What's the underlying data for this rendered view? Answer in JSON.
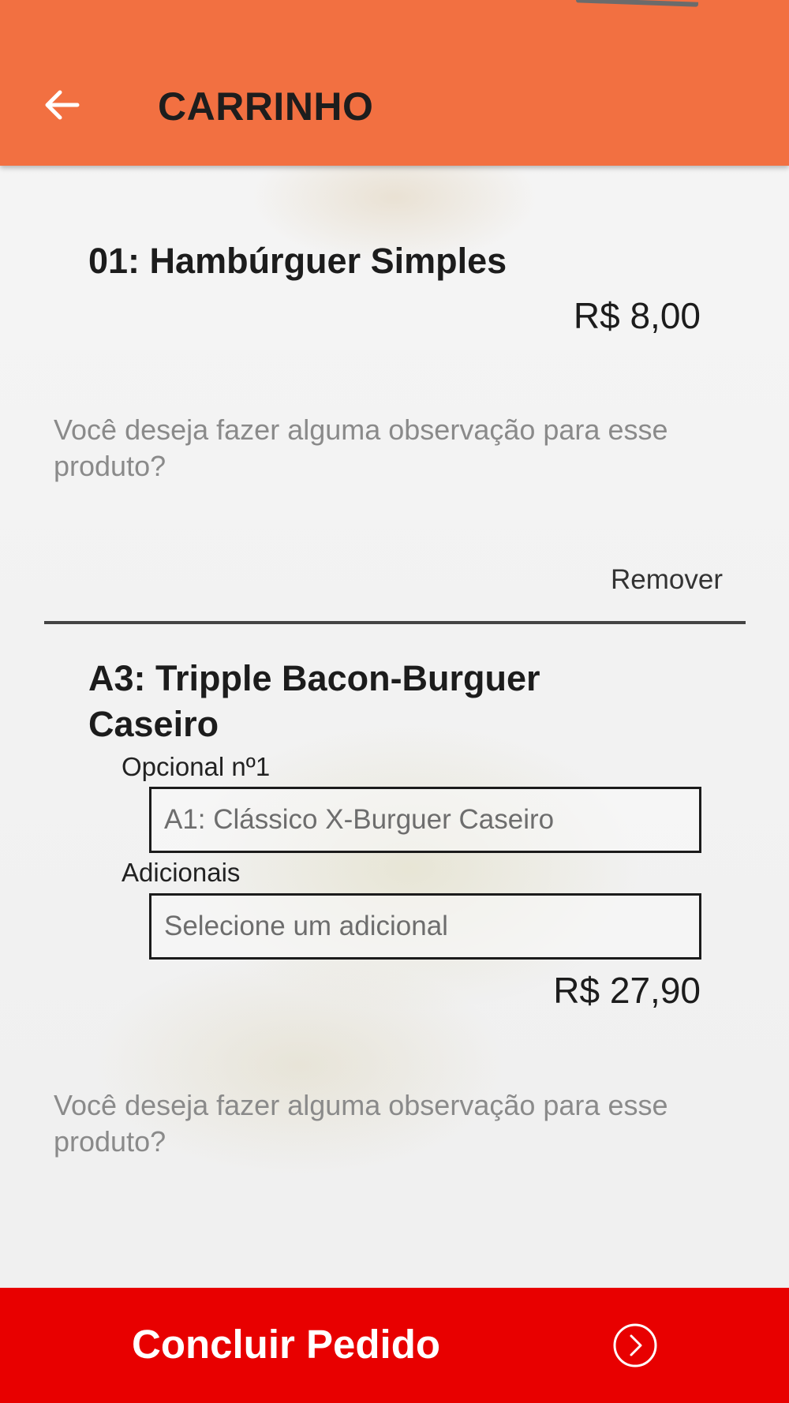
{
  "header": {
    "title": "CARRINHO",
    "back_icon": "arrow-left-icon",
    "background_color": "#f27041"
  },
  "cart_items": [
    {
      "title": "01: Hambúrguer Simples",
      "price": "R$ 8,00",
      "observation_placeholder": "Você deseja fazer alguma observação para esse produto?",
      "remove_label": "Remover"
    },
    {
      "title_line1": "A3: Tripple Bacon-Burguer",
      "title_line2": "Caseiro",
      "optional_label": "Opcional nº1",
      "optional_value": "A1: Clássico X-Burguer Caseiro",
      "additional_label": "Adicionais",
      "additional_placeholder": "Selecione um adicional",
      "price": "R$ 27,90",
      "observation_placeholder": "Você deseja fazer alguma observação para esse produto?"
    }
  ],
  "footer": {
    "button_label": "Concluir Pedido",
    "button_icon": "chevron-right-circle-icon",
    "background_color": "#e80000"
  }
}
